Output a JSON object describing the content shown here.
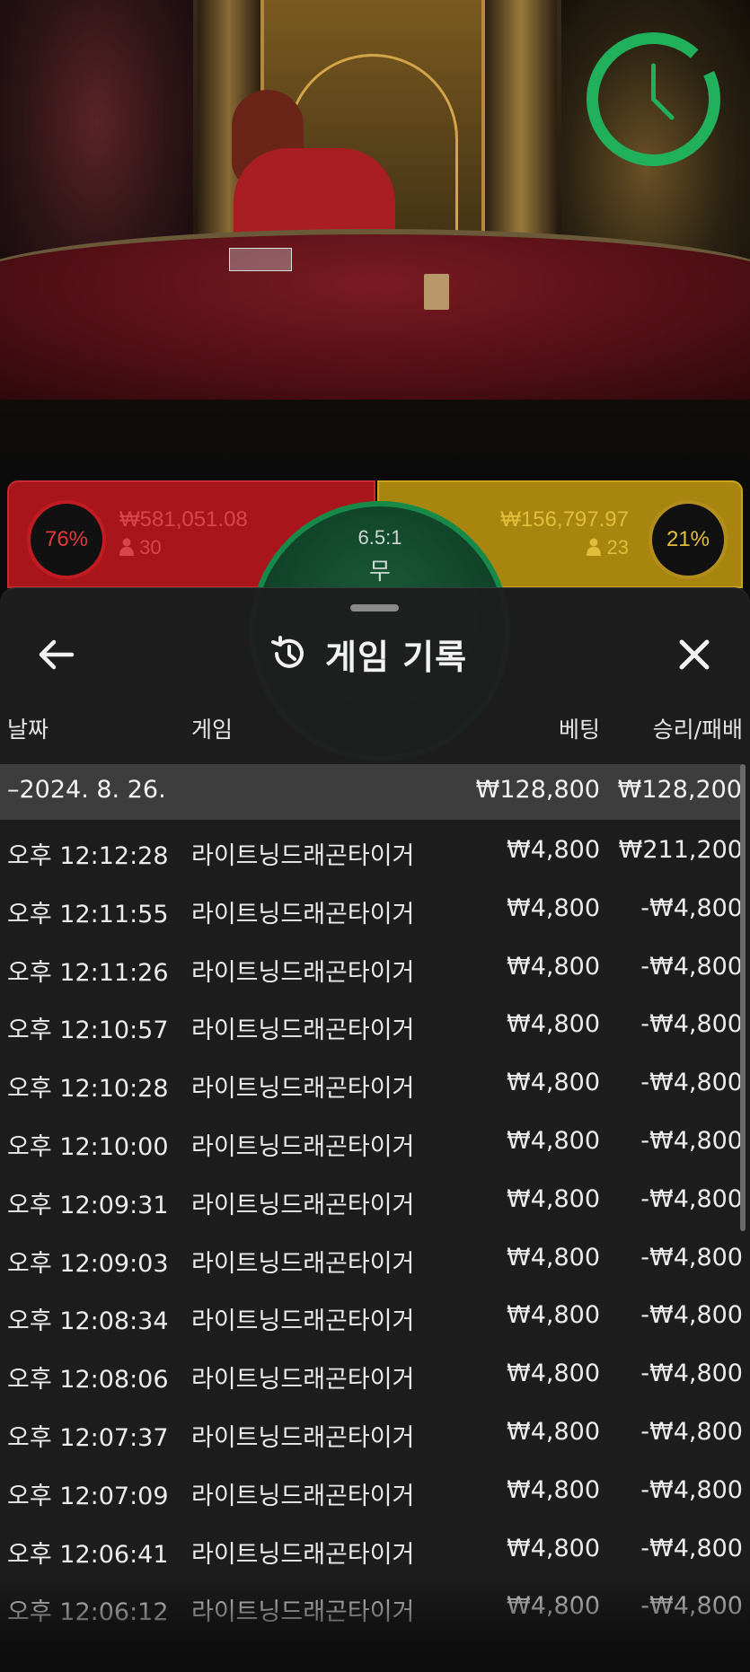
{
  "timer": {
    "icon": "clock-icon",
    "accent": "#21b05b"
  },
  "bets": {
    "dragon": {
      "percent": "76%",
      "amount": "₩581,051.08",
      "players": "30",
      "color": "#a8161c"
    },
    "tiger": {
      "percent": "21%",
      "amount": "₩156,797.97",
      "players": "23",
      "color": "#a8850f"
    },
    "tie": {
      "odds": "6.5:1",
      "label": "무",
      "color": "#178a4a"
    }
  },
  "sheet": {
    "title": "게임 기록",
    "columns": {
      "date": "날짜",
      "game": "게임",
      "bet": "베팅",
      "result": "승리/패배"
    },
    "day": {
      "date": "–2024. 8. 26.",
      "bet": "₩128,800",
      "result": "₩128,200"
    },
    "rows": [
      {
        "time": "오후 12:12:28",
        "game": "라이트닝드래곤타이거",
        "bet": "₩4,800",
        "result": "₩211,200"
      },
      {
        "time": "오후 12:11:55",
        "game": "라이트닝드래곤타이거",
        "bet": "₩4,800",
        "result": "-₩4,800"
      },
      {
        "time": "오후 12:11:26",
        "game": "라이트닝드래곤타이거",
        "bet": "₩4,800",
        "result": "-₩4,800"
      },
      {
        "time": "오후 12:10:57",
        "game": "라이트닝드래곤타이거",
        "bet": "₩4,800",
        "result": "-₩4,800"
      },
      {
        "time": "오후 12:10:28",
        "game": "라이트닝드래곤타이거",
        "bet": "₩4,800",
        "result": "-₩4,800"
      },
      {
        "time": "오후 12:10:00",
        "game": "라이트닝드래곤타이거",
        "bet": "₩4,800",
        "result": "-₩4,800"
      },
      {
        "time": "오후 12:09:31",
        "game": "라이트닝드래곤타이거",
        "bet": "₩4,800",
        "result": "-₩4,800"
      },
      {
        "time": "오후 12:09:03",
        "game": "라이트닝드래곤타이거",
        "bet": "₩4,800",
        "result": "-₩4,800"
      },
      {
        "time": "오후 12:08:34",
        "game": "라이트닝드래곤타이거",
        "bet": "₩4,800",
        "result": "-₩4,800"
      },
      {
        "time": "오후 12:08:06",
        "game": "라이트닝드래곤타이거",
        "bet": "₩4,800",
        "result": "-₩4,800"
      },
      {
        "time": "오후 12:07:37",
        "game": "라이트닝드래곤타이거",
        "bet": "₩4,800",
        "result": "-₩4,800"
      },
      {
        "time": "오후 12:07:09",
        "game": "라이트닝드래곤타이거",
        "bet": "₩4,800",
        "result": "-₩4,800"
      },
      {
        "time": "오후 12:06:41",
        "game": "라이트닝드래곤타이거",
        "bet": "₩4,800",
        "result": "-₩4,800"
      },
      {
        "time": "오후 12:06:12",
        "game": "라이트닝드래곤타이거",
        "bet": "₩4,800",
        "result": "-₩4,800"
      }
    ]
  }
}
